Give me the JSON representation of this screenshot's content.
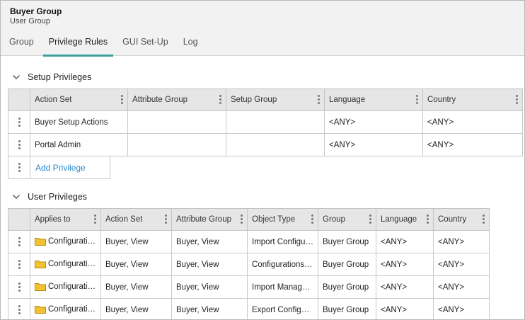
{
  "header": {
    "title": "Buyer Group",
    "subtitle": "User Group"
  },
  "tabs": [
    {
      "label": "Group",
      "active": false
    },
    {
      "label": "Privilege Rules",
      "active": true
    },
    {
      "label": "GUI Set-Up",
      "active": false
    },
    {
      "label": "Log",
      "active": false
    }
  ],
  "colors": {
    "accent": "#3aa0a0",
    "link": "#2a87c8",
    "folder": "#f2c230"
  },
  "setup_privileges": {
    "title": "Setup Privileges",
    "columns": [
      "Action Set",
      "Attribute Group",
      "Setup Group",
      "Language",
      "Country"
    ],
    "rows": [
      [
        "Buyer Setup Actions",
        "",
        "",
        "<ANY>",
        "<ANY>"
      ],
      [
        "Portal Admin",
        "",
        "",
        "<ANY>",
        "<ANY>"
      ]
    ],
    "add_label": "Add Privilege"
  },
  "user_privileges": {
    "title": "User Privileges",
    "columns": [
      "Applies to",
      "Action Set",
      "Attribute Group",
      "Object Type",
      "Group",
      "Language",
      "Country"
    ],
    "rows": [
      [
        "Configurations",
        "Buyer, View",
        "Buyer, View",
        "Import Configurations",
        "Buyer Group",
        "<ANY>",
        "<ANY>"
      ],
      [
        "Configurations",
        "Buyer, View",
        "Buyer, View",
        "Configurations Root",
        "Buyer Group",
        "<ANY>",
        "<ANY>"
      ],
      [
        "Configurations",
        "Buyer, View",
        "Buyer, View",
        "Import Manager Configurations",
        "Buyer Group",
        "<ANY>",
        "<ANY>"
      ],
      [
        "Configurations",
        "Buyer, View",
        "Buyer, View",
        "Export Configurations",
        "Buyer Group",
        "<ANY>",
        "<ANY>"
      ]
    ]
  }
}
